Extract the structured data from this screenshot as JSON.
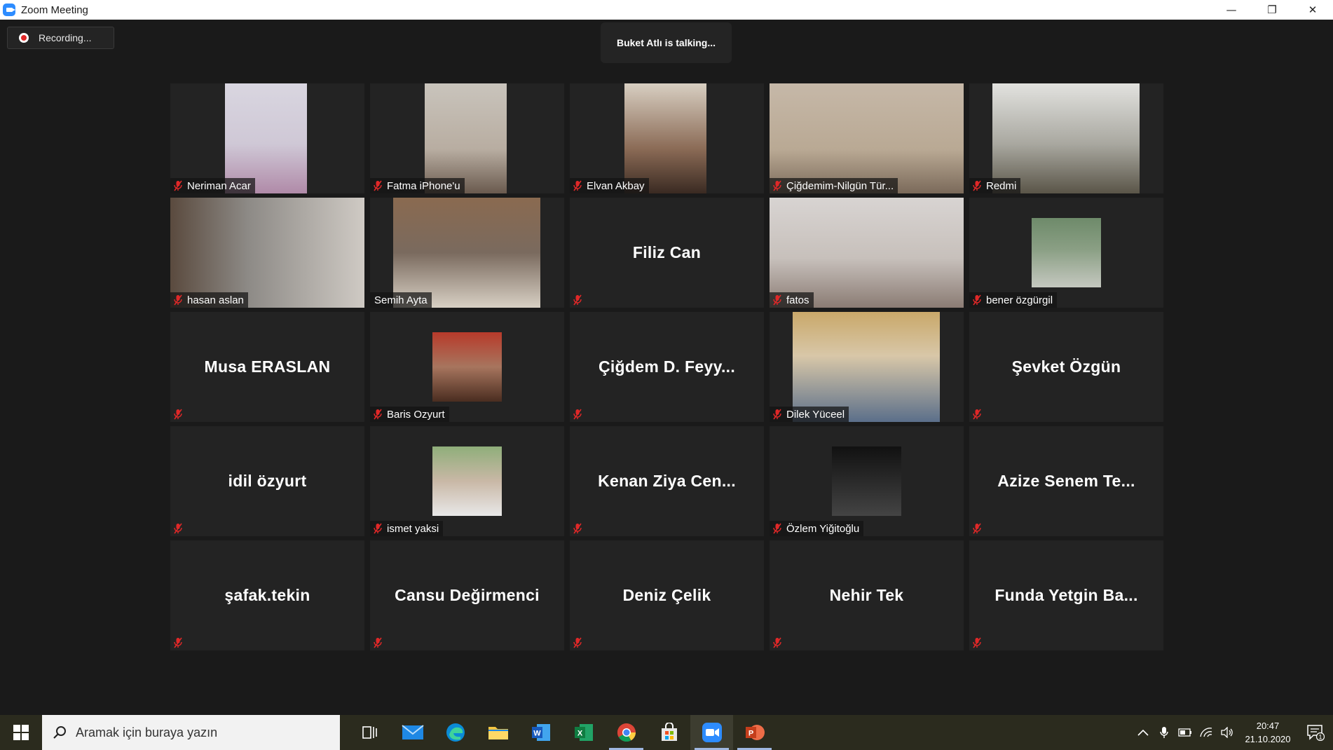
{
  "window": {
    "title": "Zoom Meeting",
    "minimize": "—",
    "maximize": "❐",
    "close": "✕"
  },
  "meeting": {
    "recording_label": "Recording...",
    "talking_banner": "Buket Atlı is talking..."
  },
  "participants": [
    {
      "name": "Neriman Acar",
      "video": true
    },
    {
      "name": "Fatma iPhone'u",
      "video": true
    },
    {
      "name": "Elvan Akbay",
      "video": true
    },
    {
      "name": "Çiğdemim-Nilgün Tür...",
      "video": true
    },
    {
      "name": "Redmi",
      "video": true
    },
    {
      "name": "hasan aslan",
      "video": true
    },
    {
      "name": "Semih Ayta",
      "video": true
    },
    {
      "name": "Filiz Can",
      "video": false
    },
    {
      "name": "fatos",
      "video": true
    },
    {
      "name": "bener özgürgil",
      "video": true
    },
    {
      "name": "Musa ERASLAN",
      "video": false
    },
    {
      "name": "Baris Ozyurt",
      "video": true
    },
    {
      "name": "Çiğdem D. Feyy...",
      "video": false
    },
    {
      "name": "Dilek Yüceel",
      "video": true
    },
    {
      "name": "Şevket Özgün",
      "video": false
    },
    {
      "name": "idil özyurt",
      "video": false
    },
    {
      "name": "ismet yaksi",
      "video": true
    },
    {
      "name": "Kenan Ziya Cen...",
      "video": false
    },
    {
      "name": "Özlem Yiğitoğlu",
      "video": true
    },
    {
      "name": "Azize Senem Te...",
      "video": false
    },
    {
      "name": "şafak.tekin",
      "video": false
    },
    {
      "name": "Cansu Değirmenci",
      "video": false
    },
    {
      "name": "Deniz Çelik",
      "video": false
    },
    {
      "name": "Nehir Tek",
      "video": false
    },
    {
      "name": "Funda Yetgin Ba...",
      "video": false
    }
  ],
  "taskbar": {
    "search_placeholder": "Aramak için buraya yazın",
    "time": "20:47",
    "date": "21.10.2020",
    "notification_count": "1",
    "apps": [
      "task-view",
      "mail",
      "edge",
      "file-explorer",
      "word",
      "excel",
      "chrome",
      "store",
      "zoom",
      "powerpoint"
    ]
  },
  "colors": {
    "mic_muted": "#e02828",
    "zoom_blue": "#2d8cff",
    "tile_bg": "#232323"
  }
}
